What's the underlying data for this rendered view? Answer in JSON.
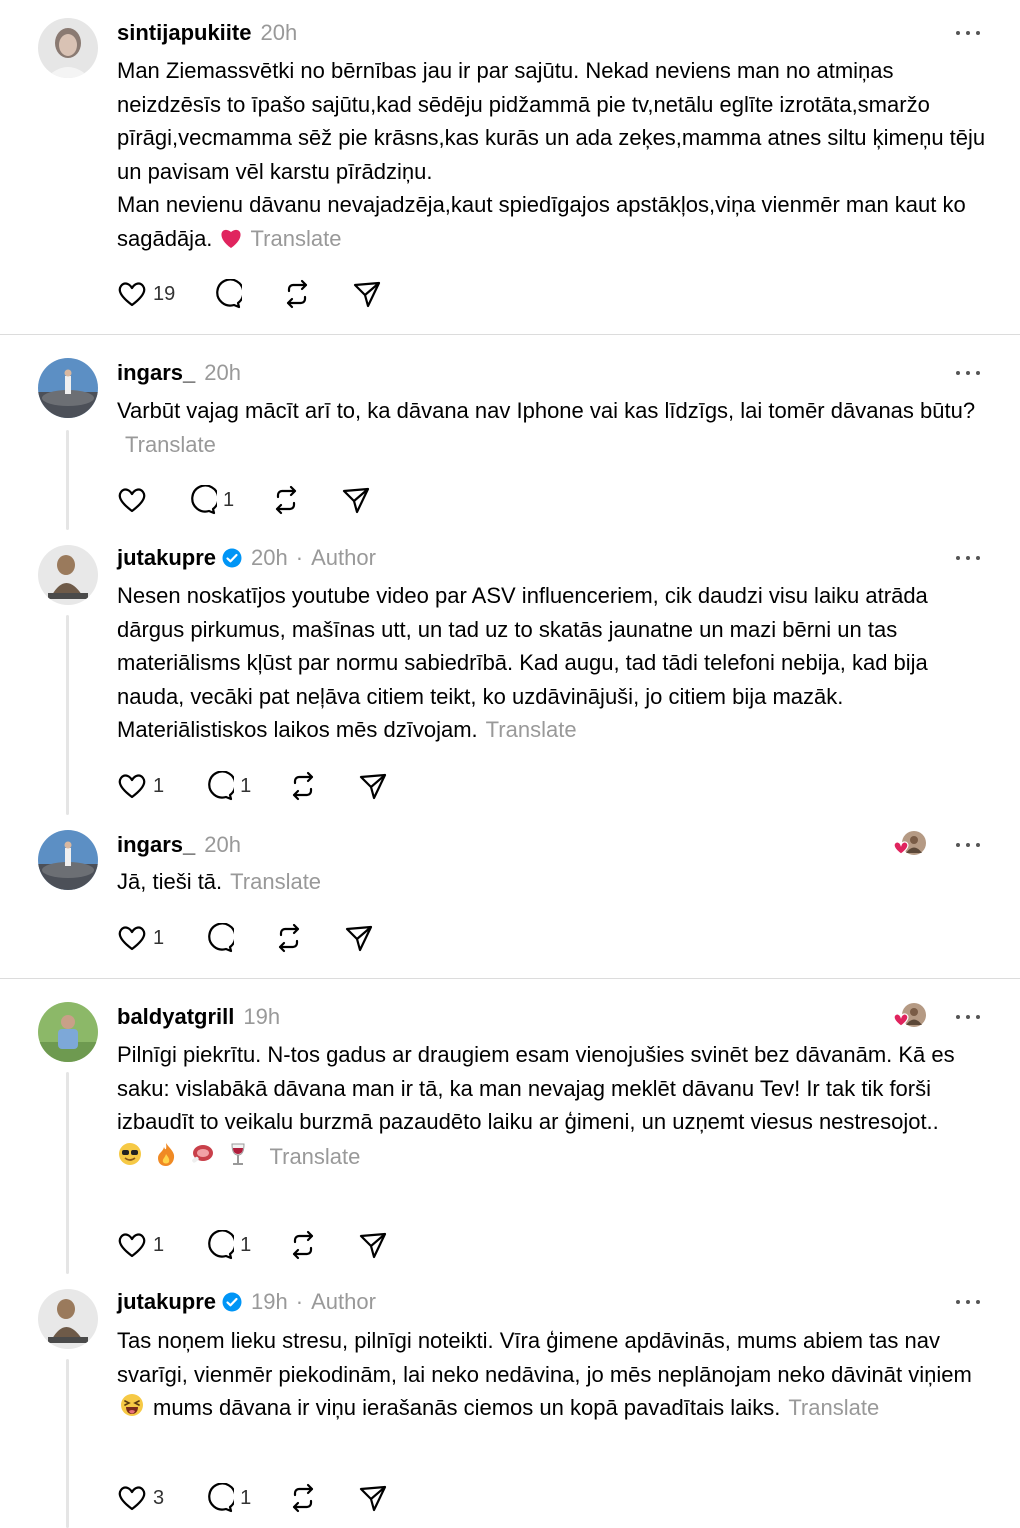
{
  "posts": [
    {
      "username": "sintijapukiite",
      "time": "20h",
      "lines": [
        "Man Ziemassvētki no bērnības jau ir par sajūtu. Nekad neviens man no atmiņas neizdzēsīs to īpašo sajūtu,kad sēdēju pidžammā pie tv,netālu eglīte izrotāta,smaržo pīrāgi,vecmamma sēž pie krāsns,kas kurās un ada zeķes,mamma atnes siltu ķimeņu tēju un pavisam vēl karstu pīrādziņu.",
        "Man nevienu dāvanu nevajadzēja,kaut spiedīgajos apstākļos,viņa vienmēr man kaut ko sagādāja."
      ],
      "translate": "Translate",
      "likes": "19",
      "replies": ""
    },
    {
      "username": "ingars_",
      "time": "20h",
      "lines": [
        "Varbūt vajag mācīt arī to, ka dāvana nav Iphone vai kas līdzīgs, lai tomēr dāvanas būtu?"
      ],
      "translate": "Translate",
      "likes": "",
      "replies": "1"
    },
    {
      "username": "jutakupre",
      "time": "20h",
      "author": "Author",
      "lines": [
        "Nesen noskatījos youtube video par ASV influenceriem, cik daudzi visu laiku atrāda dārgus pirkumus, mašīnas utt, un tad uz to skatās jaunatne un mazi bērni un tas materiālisms kļūst par normu sabiedrībā. Kad augu, tad tādi telefoni nebija, kad bija nauda, vecāki pat neļāva citiem teikt, ko uzdāvinājuši, jo citiem bija mazāk. Materiālistiskos laikos mēs dzīvojam."
      ],
      "translate": "Translate",
      "likes": "1",
      "replies": "1"
    },
    {
      "username": "ingars_",
      "time": "20h",
      "lines": [
        "Jā, tieši tā."
      ],
      "translate": "Translate",
      "likes": "1",
      "replies": ""
    },
    {
      "username": "baldyatgrill",
      "time": "19h",
      "lines": [
        "Pilnīgi piekrītu. N-tos gadus ar draugiem esam vienojušies svinēt bez dāvanām. Kā es saku: vislabākā dāvana man ir tā, ka man nevajag meklēt dāvanu Tev! Ir tak tik forši izbaudīt to veikalu burzmā pazaudēto laiku ar ģimeni, un uzņemt viesus nestresojot.."
      ],
      "translate": "Translate",
      "likes": "1",
      "replies": "1"
    },
    {
      "username": "jutakupre",
      "time": "19h",
      "author": "Author",
      "lines": [
        "Tas noņem lieku stresu, pilnīgi noteikti. Vīra ģimene apdāvinās, mums abiem tas nav svarīgi, vienmēr piekodinām, lai neko nedāvina, jo mēs neplānojam neko dāvināt viņiem",
        "mums dāvana ir viņu ierašanās ciemos un kopā pavadītais laiks."
      ],
      "translate": "Translate",
      "likes": "3",
      "replies": "1"
    }
  ],
  "colors": {
    "verified": "#0095f6",
    "muted": "#999999",
    "heart": "#e0245e"
  },
  "icons": [
    "heart-icon",
    "comment-icon",
    "repost-icon",
    "share-icon",
    "more-icon",
    "verified-icon"
  ]
}
